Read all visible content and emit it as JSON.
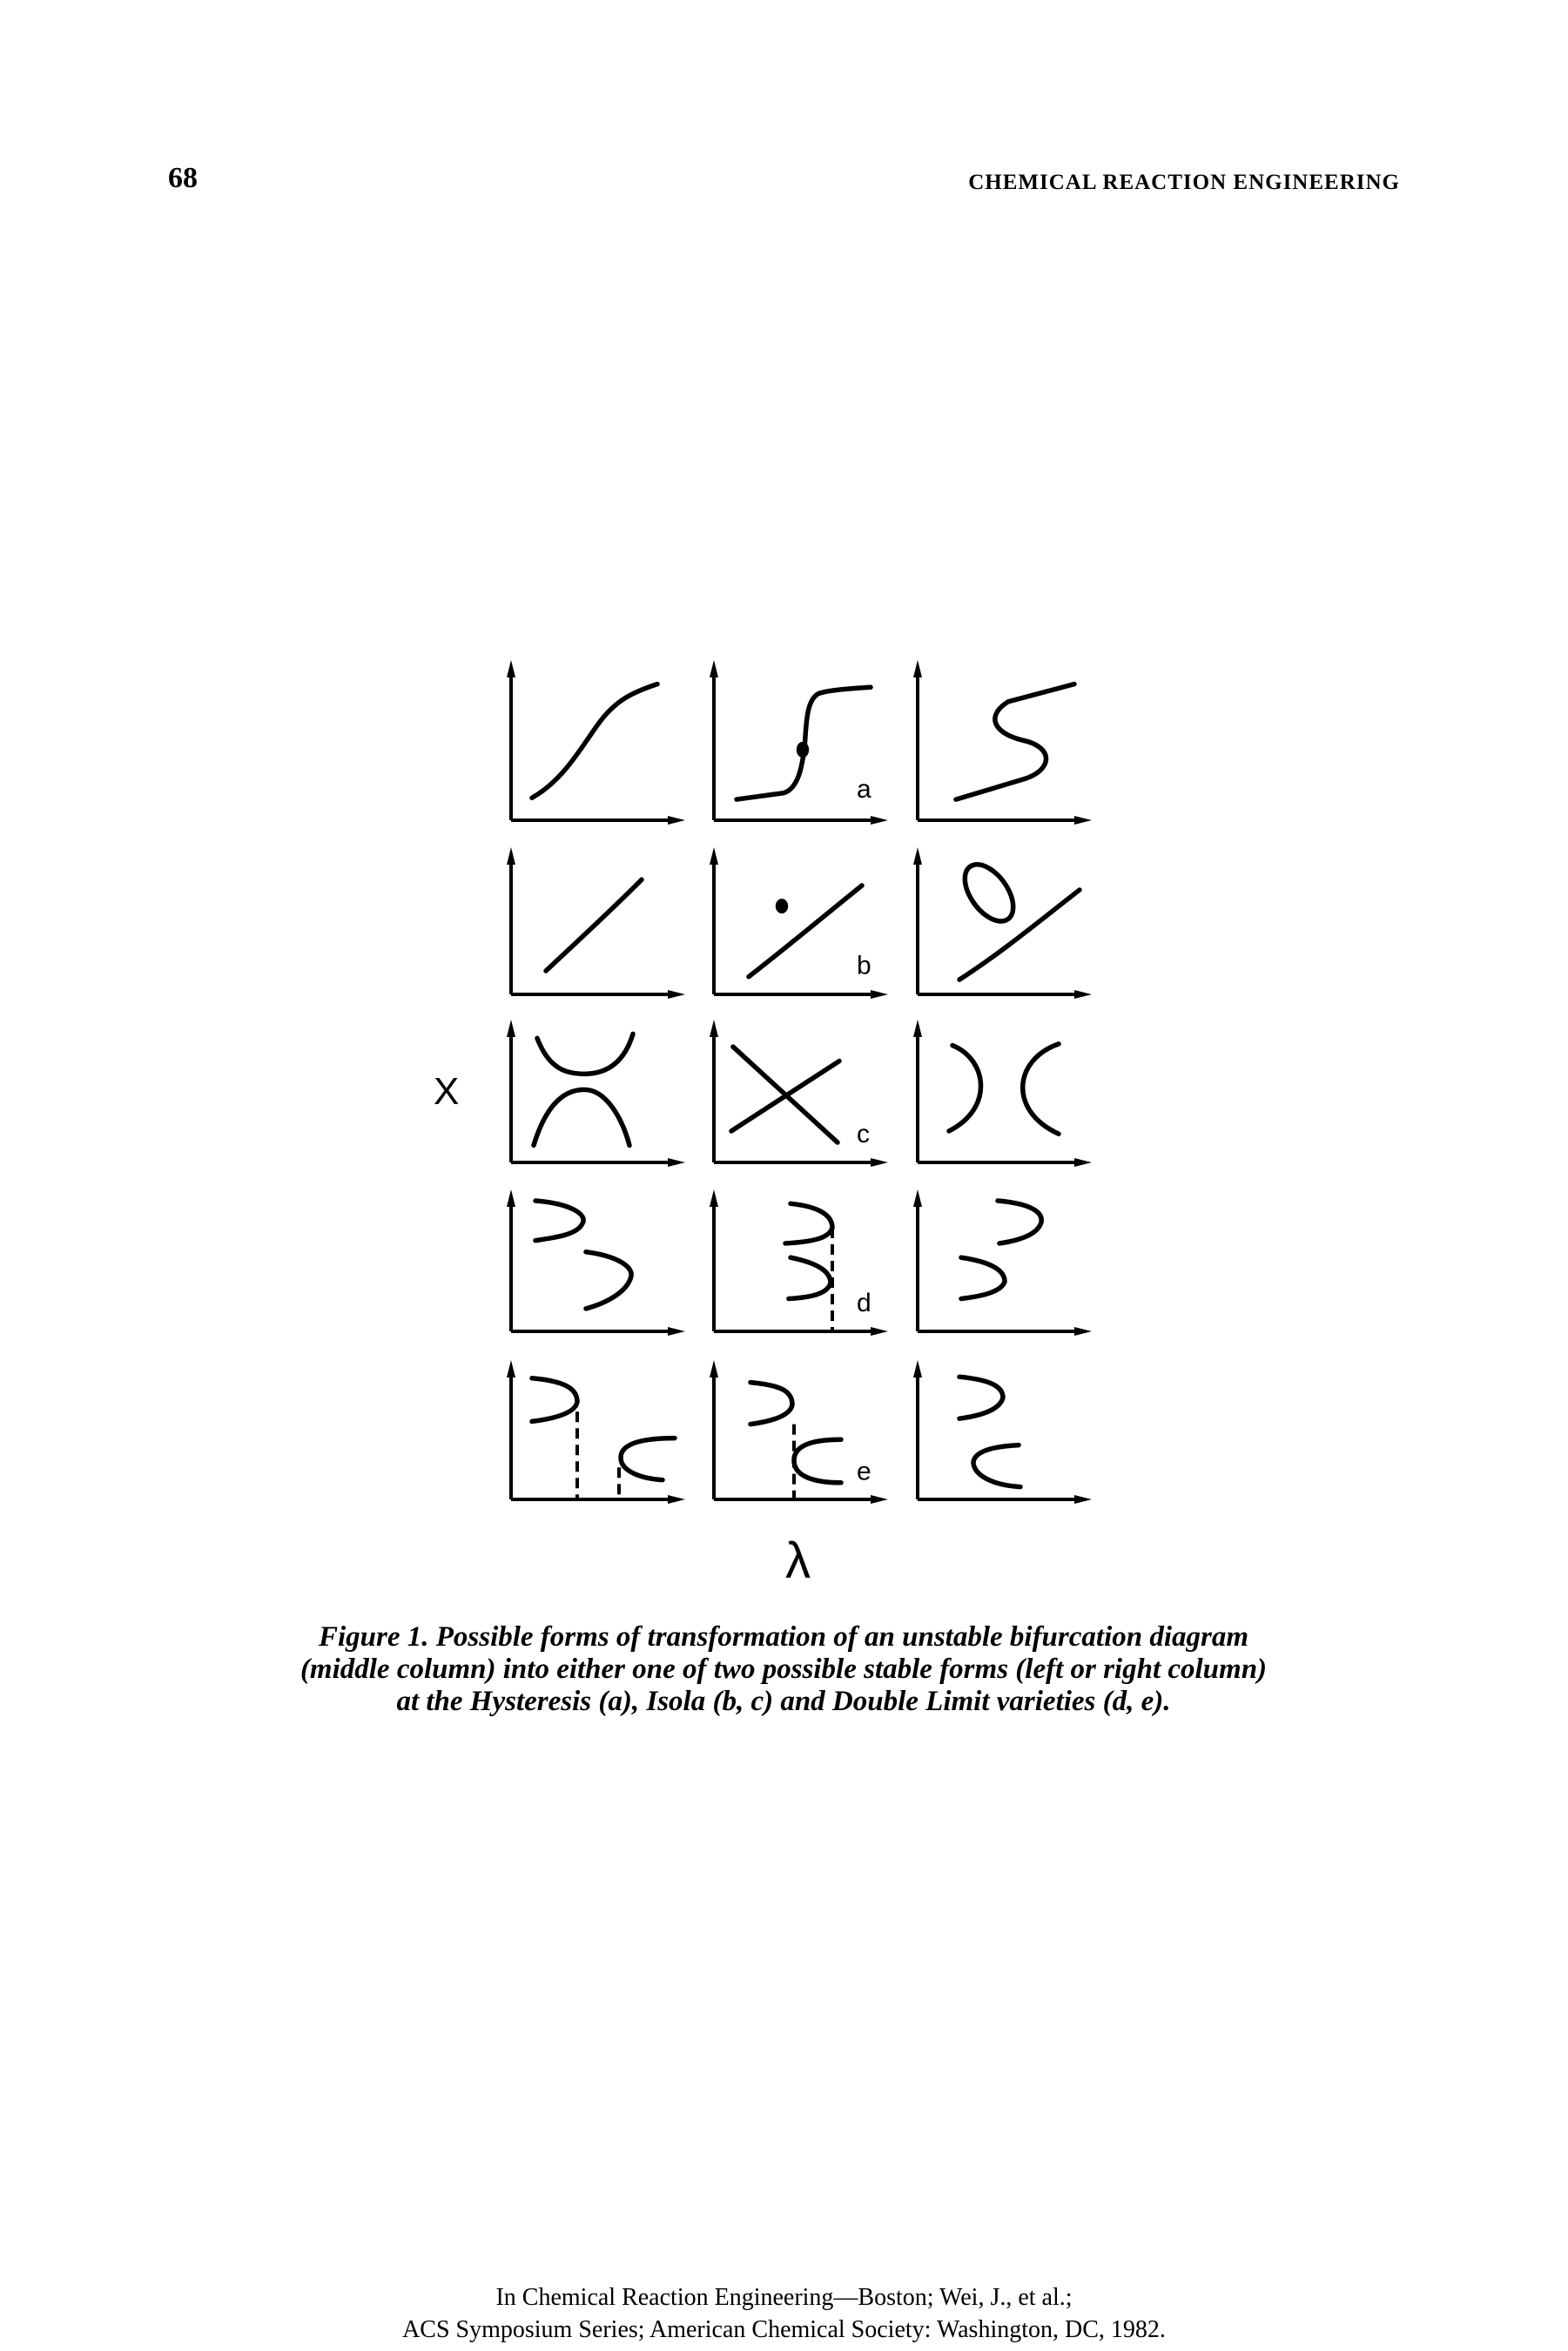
{
  "header": {
    "page_number": "68",
    "running_title": "CHEMICAL REACTION ENGINEERING"
  },
  "figure": {
    "y_axis_label": "X",
    "x_axis_label": "λ",
    "row_labels": [
      "a",
      "b",
      "c",
      "d",
      "e"
    ],
    "caption_lines": [
      "Figure 1.  Possible forms of transformation of an unstable bifurcation diagram",
      "(middle column) into either one of two possible stable forms (left or right column)",
      "at the Hysteresis (a), Isola (b, c) and Double Limit varieties (d, e)."
    ]
  },
  "footer": {
    "lines": [
      "In Chemical Reaction Engineering—Boston; Wei, J., et al.;",
      "ACS Symposium Series; American Chemical Society: Washington, DC, 1982."
    ]
  }
}
